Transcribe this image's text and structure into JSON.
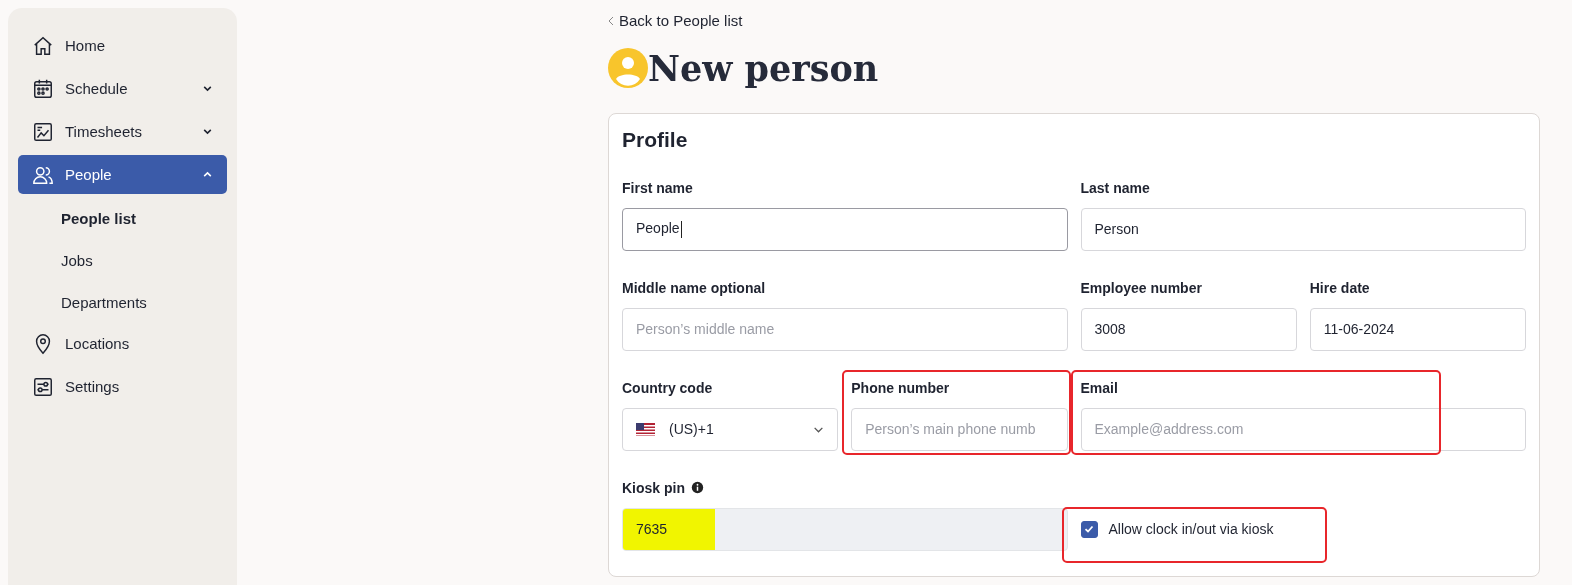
{
  "sidebar": {
    "items": [
      {
        "label": "Home",
        "selected": false
      },
      {
        "label": "Schedule",
        "selected": false,
        "expanded": false
      },
      {
        "label": "Timesheets",
        "selected": false,
        "expanded": false
      },
      {
        "label": "People",
        "selected": true,
        "expanded": true,
        "children": [
          {
            "label": "People list",
            "selected": true
          },
          {
            "label": "Jobs",
            "selected": false
          },
          {
            "label": "Departments",
            "selected": false
          }
        ]
      },
      {
        "label": "Locations",
        "selected": false
      },
      {
        "label": "Settings",
        "selected": false
      }
    ]
  },
  "back_link": "Back to People list",
  "page_title": "New person",
  "profile": {
    "title": "Profile",
    "fields": [
      {
        "kind": "input",
        "label": "First name",
        "value": "People",
        "focused": true
      },
      {
        "kind": "input",
        "label": "Last name",
        "value": "Person"
      },
      {
        "kind": "input",
        "label": "Middle name optional",
        "placeholder": "Person’s middle name"
      },
      {
        "kind": "input",
        "label": "Employee number",
        "value": "3008"
      },
      {
        "kind": "input",
        "label": "Hire date",
        "value": "11-06-2024"
      },
      {
        "kind": "select",
        "label": "Country code",
        "value": "(US)+1"
      },
      {
        "kind": "input",
        "label": "Phone number",
        "placeholder": "Person’s main phone numb",
        "annotated": true
      },
      {
        "kind": "input",
        "label": "Email",
        "placeholder": "Example@address.com",
        "annotated": true
      },
      {
        "kind": "pin",
        "label": "Kiosk pin",
        "value": "7635",
        "info": true,
        "disabled": true,
        "highlighted": true
      },
      {
        "kind": "checkbox",
        "label": "Allow clock in/out via kiosk",
        "checked": true,
        "annotated": true
      }
    ]
  }
}
